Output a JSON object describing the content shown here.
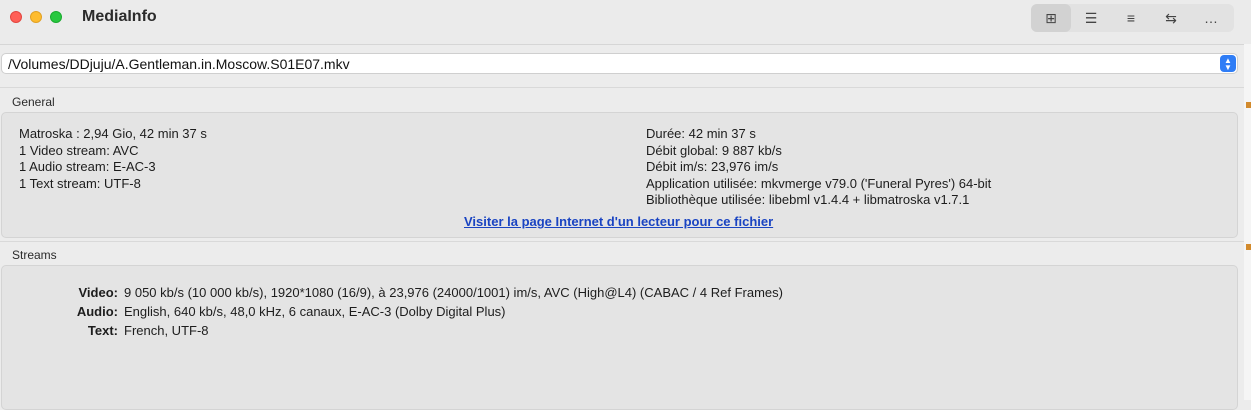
{
  "window": {
    "title": "MediaInfo",
    "toolbar": [
      {
        "icon": "grid-icon",
        "glyph": "⊞"
      },
      {
        "icon": "outline-list-icon",
        "glyph": "☰"
      },
      {
        "icon": "bullet-list-icon",
        "glyph": "≡"
      },
      {
        "icon": "swap-arrows-icon",
        "glyph": "⇆"
      },
      {
        "icon": "more-icon",
        "glyph": "…"
      }
    ]
  },
  "file": {
    "path": "/Volumes/DDjuju/A.Gentleman.in.Moscow.S01E07.mkv"
  },
  "general": {
    "label": "General",
    "left": [
      "Matroska : 2,94 Gio, 42 min 37 s",
      "1 Video stream: AVC",
      "1 Audio stream: E-AC-3",
      "1 Text stream: UTF-8"
    ],
    "right": [
      "Durée: 42 min 37 s",
      "Débit global: 9 887 kb/s",
      "Débit im/s: 23,976 im/s",
      "Application utilisée: mkvmerge v79.0 ('Funeral Pyres') 64-bit",
      "Bibliothèque utilisée: libebml v1.4.4 + libmatroska v1.7.1"
    ],
    "link": "Visiter la page Internet d'un lecteur pour ce fichier"
  },
  "streams": {
    "label": "Streams",
    "items": [
      {
        "label": "Video:",
        "value": "9 050 kb/s (10 000 kb/s), 1920*1080 (16/9), à 23,976 (24000/1001) im/s, AVC (High@L4) (CABAC / 4 Ref Frames)"
      },
      {
        "label": "Audio:",
        "value": "English, 640 kb/s, 48,0 kHz, 6 canaux, E-AC-3 (Dolby Digital Plus)"
      },
      {
        "label": "Text:",
        "value": "French, UTF-8"
      }
    ]
  },
  "colors": {
    "link": "#1a44c2",
    "accent": "#2f7df6"
  }
}
